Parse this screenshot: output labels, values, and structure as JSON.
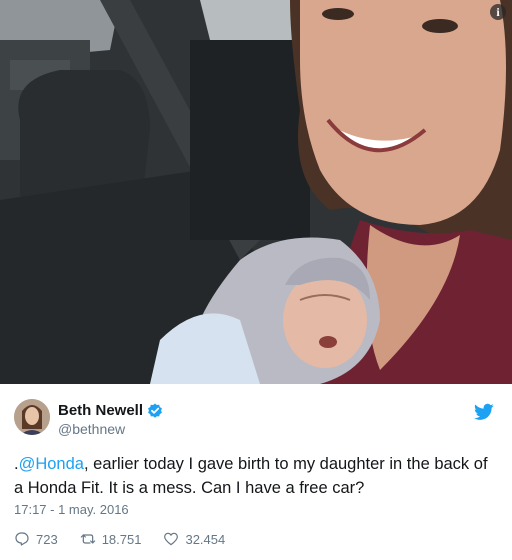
{
  "photo": {
    "alt_subject": "selfie-with-newborn-in-car"
  },
  "info_icon": "i",
  "author": {
    "name": "Beth Newell",
    "handle": "@bethnew",
    "verified": true
  },
  "tweet": {
    "mention": "@Honda",
    "text_before_mention": ".",
    "text_after_mention": ", earlier today I gave birth to my daughter in the back of a Honda Fit. It is a mess. Can I have a free car?"
  },
  "timestamp": "17:17 - 1 may. 2016",
  "actions": {
    "replies": "723",
    "retweets": "18.751",
    "likes": "32.454"
  },
  "colors": {
    "accent": "#1da1f2",
    "muted": "#657786",
    "text": "#14171a"
  },
  "icons": [
    "info-icon",
    "verified-badge-icon",
    "twitter-bird-icon",
    "reply-icon",
    "retweet-icon",
    "like-icon"
  ]
}
